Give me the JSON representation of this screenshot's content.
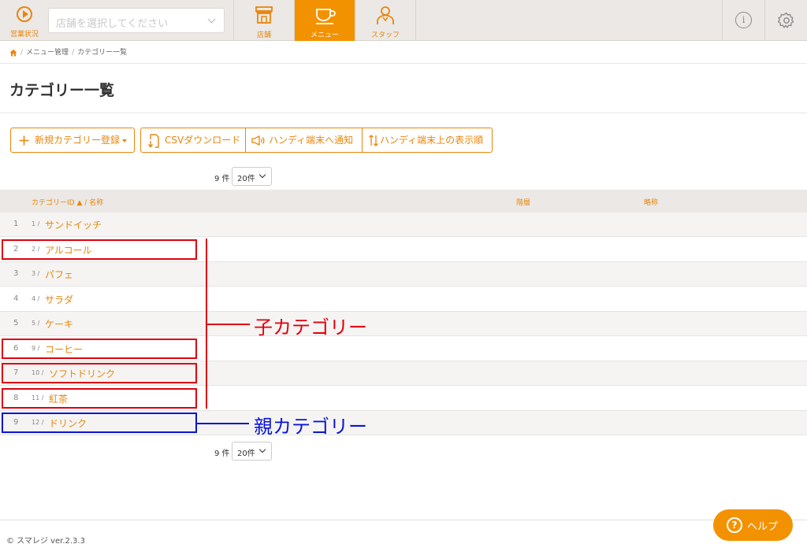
{
  "header": {
    "sales_label": "営業状況",
    "store_placeholder": "店舗を選択してください",
    "tabs": [
      {
        "label": "店舗"
      },
      {
        "label": "メニュー"
      },
      {
        "label": "スタッフ"
      }
    ],
    "accent_color": "#f39200"
  },
  "breadcrumb": {
    "items": [
      "メニュー管理",
      "カテゴリー一覧"
    ]
  },
  "page": {
    "title": "カテゴリー一覧"
  },
  "toolbar": {
    "new_category": "新規カテゴリー登録",
    "csv_download": "CSVダウンロード",
    "notify_handy": "ハンディ端末へ通知",
    "handy_order": "ハンディ端末上の表示順"
  },
  "pager": {
    "count": "9 件",
    "per_page": "20件"
  },
  "table": {
    "headers": {
      "id_name": "カテゴリーID ▲ / 名称",
      "level": "階層",
      "abbr": "略称"
    },
    "rows": [
      {
        "no": "1",
        "id": "1 /",
        "name": "サンドイッチ"
      },
      {
        "no": "2",
        "id": "2 /",
        "name": "アルコール"
      },
      {
        "no": "3",
        "id": "3 /",
        "name": "パフェ"
      },
      {
        "no": "4",
        "id": "4 /",
        "name": "サラダ"
      },
      {
        "no": "5",
        "id": "5 /",
        "name": "ケーキ"
      },
      {
        "no": "6",
        "id": "9 /",
        "name": "コーヒー"
      },
      {
        "no": "7",
        "id": "10 /",
        "name": "ソフトドリンク"
      },
      {
        "no": "8",
        "id": "11 /",
        "name": "紅茶"
      },
      {
        "no": "9",
        "id": "12 /",
        "name": "ドリンク"
      }
    ]
  },
  "annotations": {
    "child": "子カテゴリー",
    "parent": "親カテゴリー",
    "child_color": "#e0000f",
    "parent_color": "#0a14d8"
  },
  "footer": {
    "version": "© スマレジ ver.2.3.3",
    "help": "ヘルプ"
  }
}
